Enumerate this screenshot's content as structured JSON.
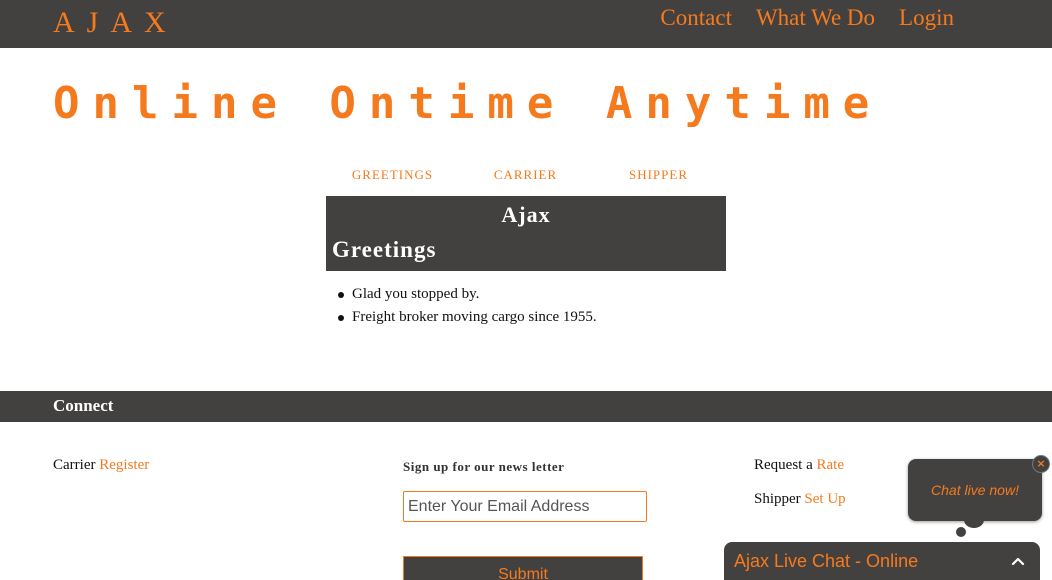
{
  "header": {
    "logo": "AJAX",
    "nav": [
      "Contact",
      "What We Do",
      "Login"
    ]
  },
  "hero": {
    "title": "Online Ontime Anytime"
  },
  "tabs": [
    "GREETINGS",
    "CARRIER",
    "SHIPPER"
  ],
  "panel": {
    "title": "Ajax",
    "subtitle": "Greetings",
    "bullets": [
      "Glad you stopped by.",
      "Freight broker moving cargo since 1955."
    ]
  },
  "footer": {
    "connect_title": "Connect",
    "carrier_label": "Carrier",
    "carrier_link": "Register",
    "newsletter_heading": "Sign up for our news letter",
    "email_placeholder": "Enter Your Email Address",
    "submit_label": "Submit",
    "request_label": "Request a",
    "request_link": "Rate",
    "shipper_label": "Shipper",
    "shipper_link": "Set Up"
  },
  "chat": {
    "bubble_text": "Chat live now!",
    "close_glyph": "×",
    "bar_title": "Ajax Live Chat - Online",
    "toggle_icon": "chevron-up-icon"
  },
  "colors": {
    "accent": "#f57a1e",
    "dark": "#434140"
  }
}
